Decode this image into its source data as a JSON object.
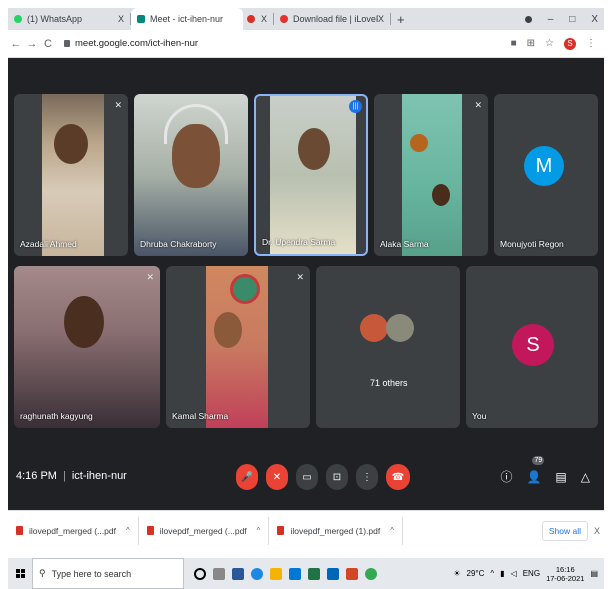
{
  "browser": {
    "tabs": [
      {
        "label": "(1) WhatsApp",
        "favicon_color": "#25d366",
        "active": false
      },
      {
        "label": "Meet - ict-ihen-nur",
        "favicon_color": "#00897b",
        "active": true
      },
      {
        "label": "Download file | iLovePDF",
        "favicon_color": "#e5322d",
        "active": false
      }
    ],
    "new_tab": "+",
    "close_glyph": "X",
    "window_controls": [
      "–",
      "□",
      "X"
    ],
    "url": "meet.google.com/ict-ihen-nur",
    "profile_initial": "S"
  },
  "meet": {
    "tiles": [
      {
        "name": "Azadali Ahmed",
        "type": "video"
      },
      {
        "name": "Dhruba Chakraborty",
        "type": "video"
      },
      {
        "name": "Dr. Upendra Sarma",
        "type": "video",
        "speaking": true
      },
      {
        "name": "Alaka Sarma",
        "type": "video"
      },
      {
        "name": "Monujyoti Regon",
        "type": "avatar",
        "initial": "M",
        "color": "#039be5"
      },
      {
        "name": "raghunath kagyung",
        "type": "video"
      },
      {
        "name": "Kamal Sharma",
        "type": "video"
      },
      {
        "name": "",
        "type": "others",
        "others_label": "71 others"
      },
      {
        "name": "You",
        "type": "avatar",
        "initial": "S",
        "color": "#c2185b"
      }
    ],
    "time": "4:16 PM",
    "separator": "|",
    "meeting_code": "ict-ihen-nur",
    "participants_badge": "79"
  },
  "downloads": {
    "items": [
      "ilovepdf_merged (...pdf",
      "ilovepdf_merged (...pdf",
      "ilovepdf_merged (1).pdf"
    ],
    "caret": "^",
    "show_all": "Show all",
    "close": "X"
  },
  "taskbar": {
    "search_placeholder": "Type here to search",
    "temperature": "29°C",
    "language": "ENG",
    "time": "16:16",
    "date": "17-06-2021"
  },
  "colors": {
    "meet_bg": "#202124",
    "tile_bg": "#3c4043",
    "accent_red": "#ea4335",
    "accent_blue": "#1a73e8"
  }
}
